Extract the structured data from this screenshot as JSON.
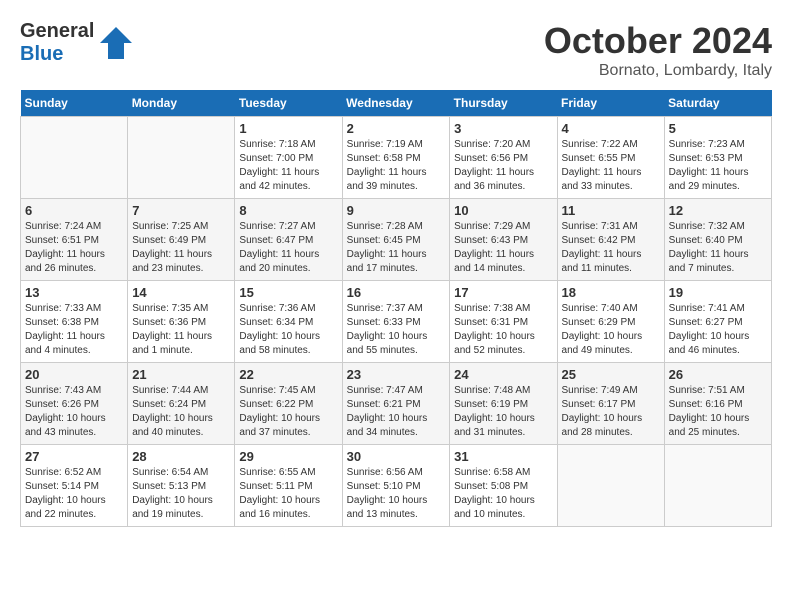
{
  "header": {
    "logo_general": "General",
    "logo_blue": "Blue",
    "month_year": "October 2024",
    "location": "Bornato, Lombardy, Italy"
  },
  "days_of_week": [
    "Sunday",
    "Monday",
    "Tuesday",
    "Wednesday",
    "Thursday",
    "Friday",
    "Saturday"
  ],
  "weeks": [
    [
      {
        "day": "",
        "info": ""
      },
      {
        "day": "",
        "info": ""
      },
      {
        "day": "1",
        "info": "Sunrise: 7:18 AM\nSunset: 7:00 PM\nDaylight: 11 hours and 42 minutes."
      },
      {
        "day": "2",
        "info": "Sunrise: 7:19 AM\nSunset: 6:58 PM\nDaylight: 11 hours and 39 minutes."
      },
      {
        "day": "3",
        "info": "Sunrise: 7:20 AM\nSunset: 6:56 PM\nDaylight: 11 hours and 36 minutes."
      },
      {
        "day": "4",
        "info": "Sunrise: 7:22 AM\nSunset: 6:55 PM\nDaylight: 11 hours and 33 minutes."
      },
      {
        "day": "5",
        "info": "Sunrise: 7:23 AM\nSunset: 6:53 PM\nDaylight: 11 hours and 29 minutes."
      }
    ],
    [
      {
        "day": "6",
        "info": "Sunrise: 7:24 AM\nSunset: 6:51 PM\nDaylight: 11 hours and 26 minutes."
      },
      {
        "day": "7",
        "info": "Sunrise: 7:25 AM\nSunset: 6:49 PM\nDaylight: 11 hours and 23 minutes."
      },
      {
        "day": "8",
        "info": "Sunrise: 7:27 AM\nSunset: 6:47 PM\nDaylight: 11 hours and 20 minutes."
      },
      {
        "day": "9",
        "info": "Sunrise: 7:28 AM\nSunset: 6:45 PM\nDaylight: 11 hours and 17 minutes."
      },
      {
        "day": "10",
        "info": "Sunrise: 7:29 AM\nSunset: 6:43 PM\nDaylight: 11 hours and 14 minutes."
      },
      {
        "day": "11",
        "info": "Sunrise: 7:31 AM\nSunset: 6:42 PM\nDaylight: 11 hours and 11 minutes."
      },
      {
        "day": "12",
        "info": "Sunrise: 7:32 AM\nSunset: 6:40 PM\nDaylight: 11 hours and 7 minutes."
      }
    ],
    [
      {
        "day": "13",
        "info": "Sunrise: 7:33 AM\nSunset: 6:38 PM\nDaylight: 11 hours and 4 minutes."
      },
      {
        "day": "14",
        "info": "Sunrise: 7:35 AM\nSunset: 6:36 PM\nDaylight: 11 hours and 1 minute."
      },
      {
        "day": "15",
        "info": "Sunrise: 7:36 AM\nSunset: 6:34 PM\nDaylight: 10 hours and 58 minutes."
      },
      {
        "day": "16",
        "info": "Sunrise: 7:37 AM\nSunset: 6:33 PM\nDaylight: 10 hours and 55 minutes."
      },
      {
        "day": "17",
        "info": "Sunrise: 7:38 AM\nSunset: 6:31 PM\nDaylight: 10 hours and 52 minutes."
      },
      {
        "day": "18",
        "info": "Sunrise: 7:40 AM\nSunset: 6:29 PM\nDaylight: 10 hours and 49 minutes."
      },
      {
        "day": "19",
        "info": "Sunrise: 7:41 AM\nSunset: 6:27 PM\nDaylight: 10 hours and 46 minutes."
      }
    ],
    [
      {
        "day": "20",
        "info": "Sunrise: 7:43 AM\nSunset: 6:26 PM\nDaylight: 10 hours and 43 minutes."
      },
      {
        "day": "21",
        "info": "Sunrise: 7:44 AM\nSunset: 6:24 PM\nDaylight: 10 hours and 40 minutes."
      },
      {
        "day": "22",
        "info": "Sunrise: 7:45 AM\nSunset: 6:22 PM\nDaylight: 10 hours and 37 minutes."
      },
      {
        "day": "23",
        "info": "Sunrise: 7:47 AM\nSunset: 6:21 PM\nDaylight: 10 hours and 34 minutes."
      },
      {
        "day": "24",
        "info": "Sunrise: 7:48 AM\nSunset: 6:19 PM\nDaylight: 10 hours and 31 minutes."
      },
      {
        "day": "25",
        "info": "Sunrise: 7:49 AM\nSunset: 6:17 PM\nDaylight: 10 hours and 28 minutes."
      },
      {
        "day": "26",
        "info": "Sunrise: 7:51 AM\nSunset: 6:16 PM\nDaylight: 10 hours and 25 minutes."
      }
    ],
    [
      {
        "day": "27",
        "info": "Sunrise: 6:52 AM\nSunset: 5:14 PM\nDaylight: 10 hours and 22 minutes."
      },
      {
        "day": "28",
        "info": "Sunrise: 6:54 AM\nSunset: 5:13 PM\nDaylight: 10 hours and 19 minutes."
      },
      {
        "day": "29",
        "info": "Sunrise: 6:55 AM\nSunset: 5:11 PM\nDaylight: 10 hours and 16 minutes."
      },
      {
        "day": "30",
        "info": "Sunrise: 6:56 AM\nSunset: 5:10 PM\nDaylight: 10 hours and 13 minutes."
      },
      {
        "day": "31",
        "info": "Sunrise: 6:58 AM\nSunset: 5:08 PM\nDaylight: 10 hours and 10 minutes."
      },
      {
        "day": "",
        "info": ""
      },
      {
        "day": "",
        "info": ""
      }
    ]
  ]
}
